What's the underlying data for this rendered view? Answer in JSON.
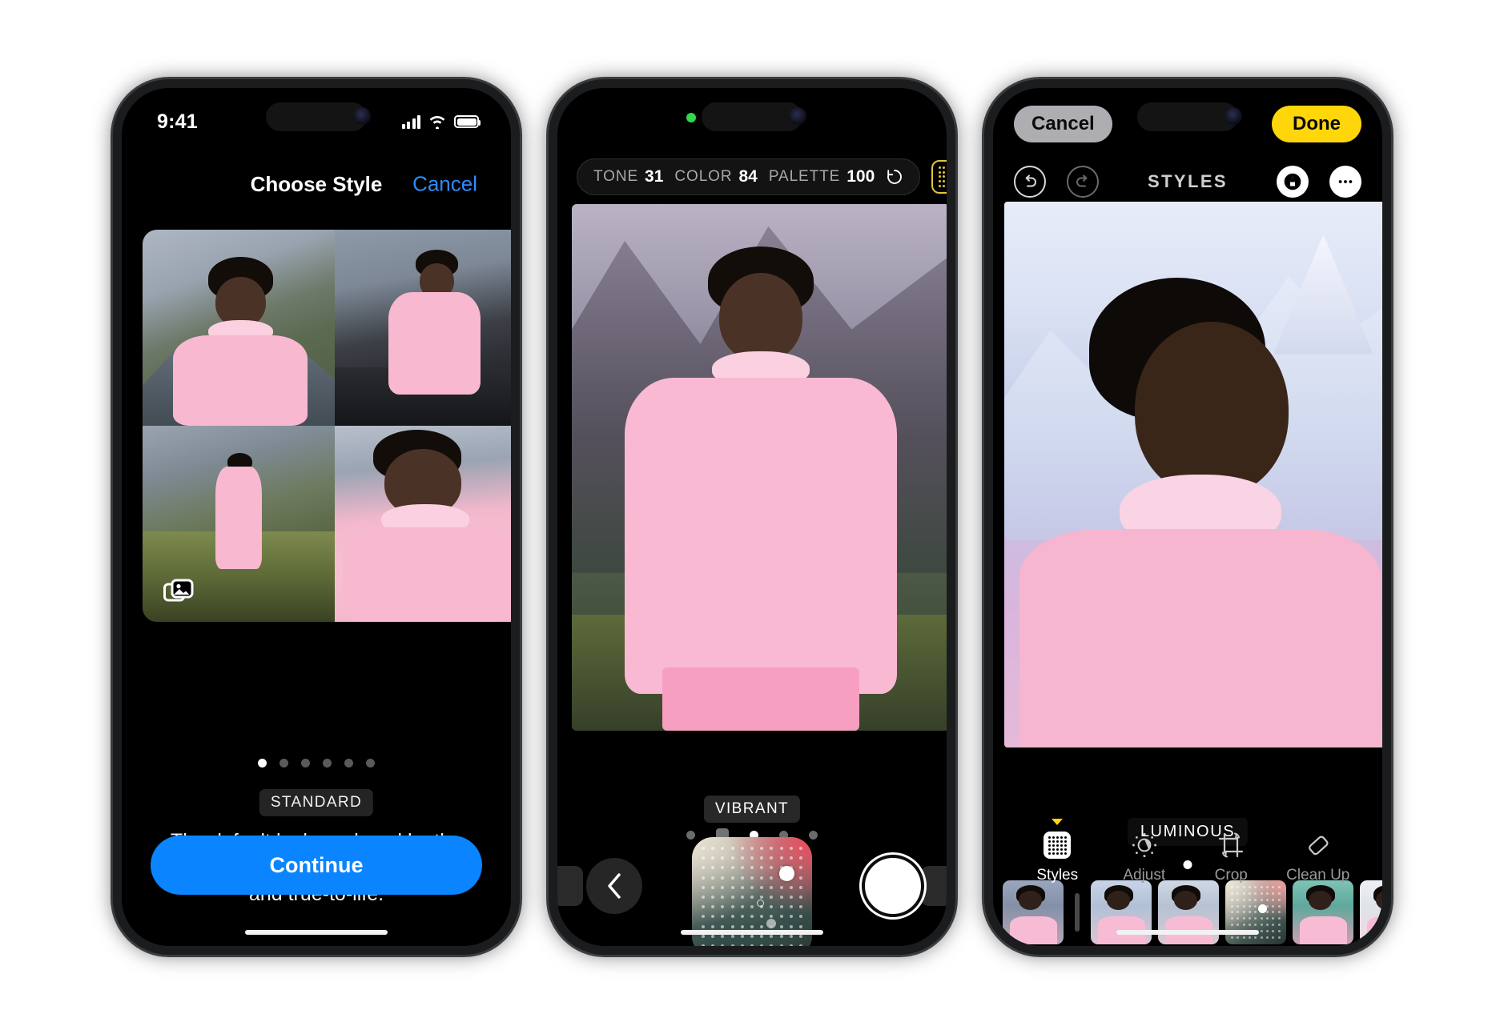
{
  "phone1": {
    "statusbar": {
      "time": "9:41",
      "signal_icon": "cellular-bars-icon",
      "wifi_icon": "wifi-icon",
      "battery_icon": "battery-icon"
    },
    "nav": {
      "title": "Choose Style",
      "cancel_label": "Cancel"
    },
    "grid": {
      "stack_icon": "photo-stack-icon",
      "tiles": [
        {
          "name": "tile-portrait-mountain"
        },
        {
          "name": "tile-beach-standing"
        },
        {
          "name": "tile-grass-fullbody"
        },
        {
          "name": "tile-profile-closeup"
        }
      ]
    },
    "pager": {
      "count": 6,
      "active_index": 0
    },
    "style_name": "STANDARD",
    "style_description": "The default look produced by the iPhone camera that is balanced and true-to-life.",
    "continue_label": "Continue",
    "accent_blue": "#0a84ff"
  },
  "phone2": {
    "toolbar": {
      "items": [
        {
          "key": "TONE",
          "value": "31"
        },
        {
          "key": "COLOR",
          "value": "84"
        },
        {
          "key": "PALETTE",
          "value": "100"
        }
      ],
      "reset_icon": "reset-arrow-icon",
      "grid_button_icon": "style-grid-icon",
      "grid_button_color": "#e2c53c"
    },
    "style_name": "VIBRANT",
    "pager": {
      "count": 5,
      "active_index": 2
    },
    "back_icon": "chevron-left-icon",
    "shutter_icon": "shutter-button-icon",
    "color_picker": {
      "name": "photographic-styles-color-picker",
      "knob": "picker-knob"
    },
    "hue_slider": {
      "name": "intensity-slider",
      "knob_position": "100"
    }
  },
  "phone3": {
    "cancel_label": "Cancel",
    "done_label": "Done",
    "done_color": "#ffd60a",
    "subtitle": "STYLES",
    "undo_icon": "undo-icon",
    "redo_icon": "redo-icon",
    "markup_icon": "markup-pen-icon",
    "more_icon": "more-ellipsis-icon",
    "style_name": "LUMINOUS",
    "pager": {
      "count": 1,
      "active_index": 0
    },
    "filmstrip": [
      {
        "name": "thumb-original"
      },
      {
        "name": "thumb-sep"
      },
      {
        "name": "thumb-style-1"
      },
      {
        "name": "thumb-style-2"
      },
      {
        "name": "thumb-color-picker"
      },
      {
        "name": "thumb-style-3"
      },
      {
        "name": "thumb-style-4"
      },
      {
        "name": "thumb-style-5"
      },
      {
        "name": "thumb-style-6"
      }
    ],
    "tabs": [
      {
        "label": "Styles",
        "icon": "styles-grid-icon",
        "active": true
      },
      {
        "label": "Adjust",
        "icon": "adjust-dial-icon",
        "active": false
      },
      {
        "label": "Crop",
        "icon": "crop-icon",
        "active": false
      },
      {
        "label": "Clean Up",
        "icon": "eraser-icon",
        "active": false
      }
    ]
  }
}
